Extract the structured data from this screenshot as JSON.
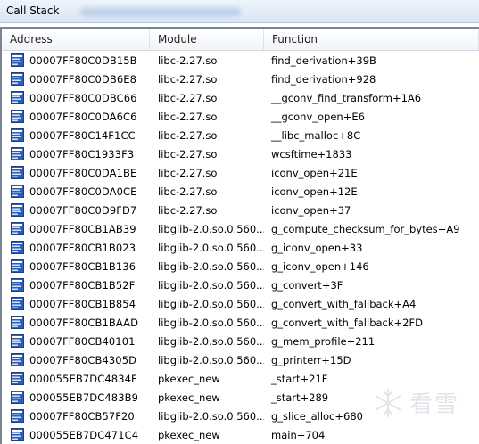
{
  "window": {
    "title": "Call Stack",
    "watermark_text": "看雪"
  },
  "columns": {
    "address": "Address",
    "module": "Module",
    "function": "Function"
  },
  "frames": [
    {
      "address": "00007FF80C0DB15B",
      "module": "libc-2.27.so",
      "function": "find_derivation+39B"
    },
    {
      "address": "00007FF80C0DB6E8",
      "module": "libc-2.27.so",
      "function": "find_derivation+928"
    },
    {
      "address": "00007FF80C0DBC66",
      "module": "libc-2.27.so",
      "function": "__gconv_find_transform+1A6"
    },
    {
      "address": "00007FF80C0DA6C6",
      "module": "libc-2.27.so",
      "function": "__gconv_open+E6"
    },
    {
      "address": "00007FF80C14F1CC",
      "module": "libc-2.27.so",
      "function": "__libc_malloc+8C"
    },
    {
      "address": "00007FF80C1933F3",
      "module": "libc-2.27.so",
      "function": "wcsftime+1833"
    },
    {
      "address": "00007FF80C0DA1BE",
      "module": "libc-2.27.so",
      "function": "iconv_open+21E"
    },
    {
      "address": "00007FF80C0DA0CE",
      "module": "libc-2.27.so",
      "function": "iconv_open+12E"
    },
    {
      "address": "00007FF80C0D9FD7",
      "module": "libc-2.27.so",
      "function": "iconv_open+37"
    },
    {
      "address": "00007FF80CB1AB39",
      "module": "libglib-2.0.so.0.560...",
      "function": "g_compute_checksum_for_bytes+A9"
    },
    {
      "address": "00007FF80CB1B023",
      "module": "libglib-2.0.so.0.560...",
      "function": "g_iconv_open+33"
    },
    {
      "address": "00007FF80CB1B136",
      "module": "libglib-2.0.so.0.560...",
      "function": "g_iconv_open+146"
    },
    {
      "address": "00007FF80CB1B52F",
      "module": "libglib-2.0.so.0.560...",
      "function": "g_convert+3F"
    },
    {
      "address": "00007FF80CB1B854",
      "module": "libglib-2.0.so.0.560...",
      "function": "g_convert_with_fallback+A4"
    },
    {
      "address": "00007FF80CB1BAAD",
      "module": "libglib-2.0.so.0.560...",
      "function": "g_convert_with_fallback+2FD"
    },
    {
      "address": "00007FF80CB40101",
      "module": "libglib-2.0.so.0.560...",
      "function": "g_mem_profile+211"
    },
    {
      "address": "00007FF80CB4305D",
      "module": "libglib-2.0.so.0.560...",
      "function": "g_printerr+15D"
    },
    {
      "address": "000055EB7DC4834F",
      "module": "pkexec_new",
      "function": "_start+21F"
    },
    {
      "address": "000055EB7DC483B9",
      "module": "pkexec_new",
      "function": "_start+289"
    },
    {
      "address": "00007FF80CB57F20",
      "module": "libglib-2.0.so.0.560...",
      "function": "g_slice_alloc+680"
    },
    {
      "address": "000055EB7DC471C4",
      "module": "pkexec_new",
      "function": "main+704"
    }
  ],
  "icons": {
    "frame": "stack-frame-icon",
    "watermark": "snowflake-icon"
  }
}
